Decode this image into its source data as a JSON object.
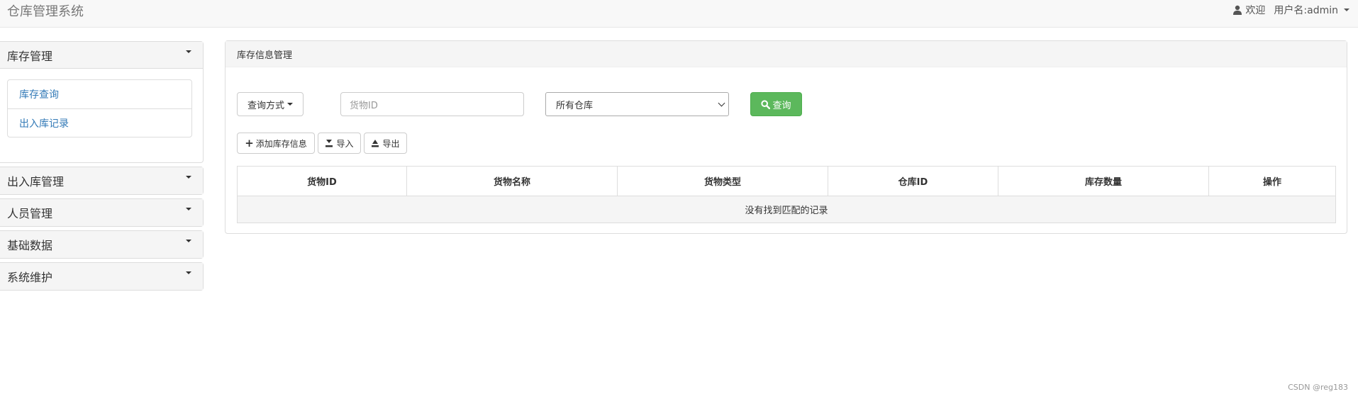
{
  "navbar": {
    "brand": "仓库管理系统",
    "welcome": "欢迎",
    "username": "用户名:admin"
  },
  "sidebar": {
    "sections": [
      {
        "title": "库存管理",
        "expanded": true,
        "items": [
          "库存查询",
          "出入库记录"
        ]
      },
      {
        "title": "出入库管理",
        "expanded": false
      },
      {
        "title": "人员管理",
        "expanded": false
      },
      {
        "title": "基础数据",
        "expanded": false
      },
      {
        "title": "系统维护",
        "expanded": false
      }
    ]
  },
  "main": {
    "title": "库存信息管理",
    "query_mode_label": "查询方式",
    "goods_id_placeholder": "货物ID",
    "warehouse_select_value": "所有仓库",
    "query_button": "查询",
    "add_button": "添加库存信息",
    "import_button": "导入",
    "export_button": "导出",
    "table": {
      "columns": [
        "货物ID",
        "货物名称",
        "货物类型",
        "仓库ID",
        "库存数量",
        "操作"
      ],
      "empty_text": "没有找到匹配的记录"
    }
  },
  "watermark": "CSDN @reg183",
  "colors": {
    "success": "#5cb85c",
    "link": "#337ab7"
  }
}
